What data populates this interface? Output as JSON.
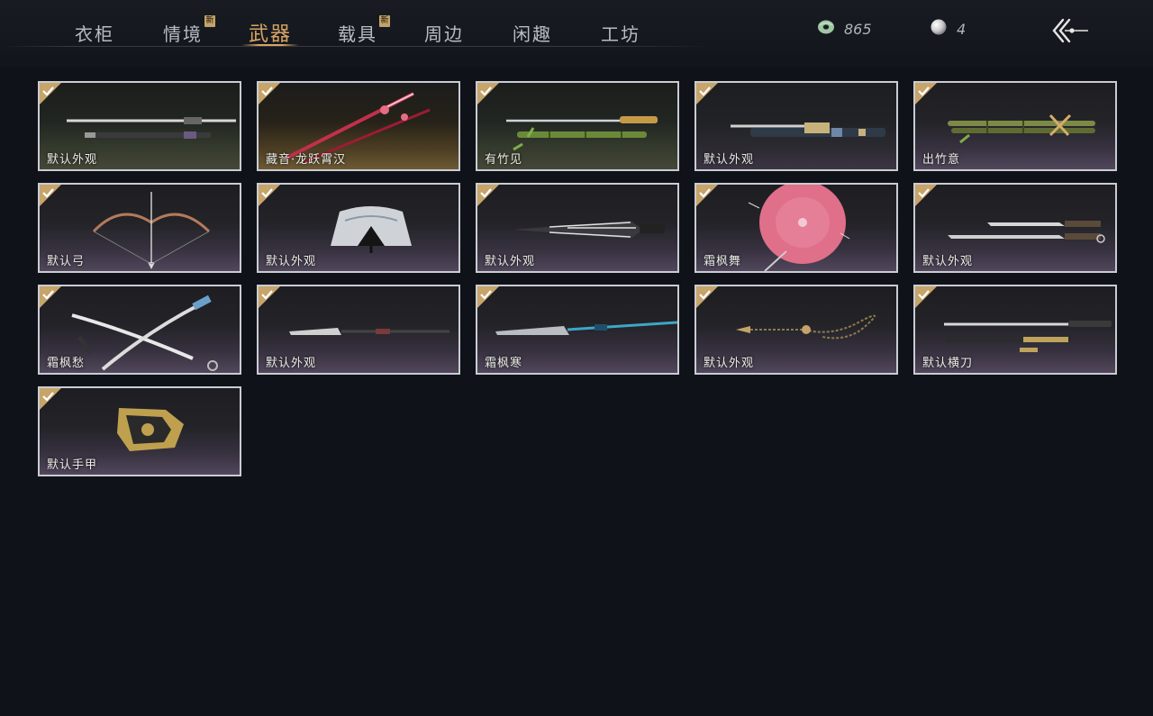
{
  "tabs": [
    {
      "label": "衣柜",
      "badge": ""
    },
    {
      "label": "情境",
      "badge": "新"
    },
    {
      "label": "武器",
      "badge": ""
    },
    {
      "label": "载具",
      "badge": "新"
    },
    {
      "label": "周边",
      "badge": ""
    },
    {
      "label": "闲趣",
      "badge": ""
    },
    {
      "label": "工坊",
      "badge": ""
    }
  ],
  "active_tab": "武器",
  "currency": {
    "jade": {
      "icon": "jade-coin-icon",
      "amount": "865"
    },
    "pearl": {
      "icon": "pearl-icon",
      "amount": "4"
    }
  },
  "colors": {
    "accent": "#d8a463",
    "badge": "#c4a36a",
    "border": "#c9ccd2",
    "background": "#0f1319"
  },
  "items": [
    {
      "name": "默认外观",
      "art": "sword-icon",
      "owned": true
    },
    {
      "name": "藏音·龙跃霄汉",
      "art": "crimson-dual-sword-icon",
      "owned": true
    },
    {
      "name": "有竹见",
      "art": "bamboo-sword-icon",
      "owned": true
    },
    {
      "name": "默认外观",
      "art": "ornate-sword-icon",
      "owned": true
    },
    {
      "name": "出竹意",
      "art": "bamboo-staff-icon",
      "owned": true
    },
    {
      "name": "默认弓",
      "art": "bow-icon",
      "owned": true
    },
    {
      "name": "默认外观",
      "art": "fan-icon",
      "owned": true
    },
    {
      "name": "默认外观",
      "art": "closed-umbrella-icon",
      "owned": true
    },
    {
      "name": "霜枫舞",
      "art": "red-umbrella-icon",
      "owned": true
    },
    {
      "name": "默认外观",
      "art": "twin-blades-icon",
      "owned": true
    },
    {
      "name": "霜枫愁",
      "art": "crossed-blades-icon",
      "owned": true
    },
    {
      "name": "默认外观",
      "art": "glaive-icon",
      "owned": true
    },
    {
      "name": "霜枫寒",
      "art": "blue-glaive-icon",
      "owned": true
    },
    {
      "name": "默认外观",
      "art": "rope-dart-icon",
      "owned": true
    },
    {
      "name": "默认横刀",
      "art": "hengdao-icon",
      "owned": true
    },
    {
      "name": "默认手甲",
      "art": "gauntlet-icon",
      "owned": true
    }
  ]
}
